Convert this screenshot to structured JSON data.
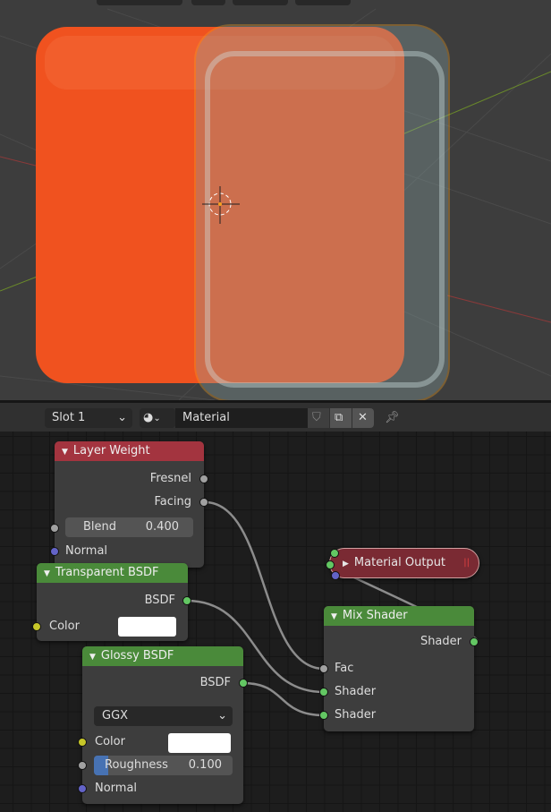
{
  "header": {
    "slot": "Slot 1",
    "material": "Material",
    "icons": [
      "sphere-shading-icon",
      "shield-icon",
      "copy-icon",
      "close-icon",
      "pin-icon"
    ]
  },
  "nodes": {
    "layer_weight": {
      "title": "Layer Weight",
      "outputs": [
        "Fresnel",
        "Facing"
      ],
      "blend_label": "Blend",
      "blend_value": "0.400",
      "normal": "Normal"
    },
    "transparent": {
      "title": "Transparent BSDF",
      "output": "BSDF",
      "color": "Color",
      "color_value": "#ffffff"
    },
    "glossy": {
      "title": "Glossy BSDF",
      "output": "BSDF",
      "distribution": "GGX",
      "color": "Color",
      "color_value": "#ffffff",
      "roughness_label": "Roughness",
      "roughness_value": "0.100",
      "roughness": 0.1,
      "normal": "Normal"
    },
    "mix": {
      "title": "Mix Shader",
      "output": "Shader",
      "inputs": [
        "Fac",
        "Shader",
        "Shader"
      ]
    },
    "output": {
      "title": "Material Output"
    }
  },
  "colors": {
    "header_red": "#a3343f",
    "header_green": "#4a8a3a",
    "cube": "#f0521f",
    "selection": "#f5a020"
  }
}
